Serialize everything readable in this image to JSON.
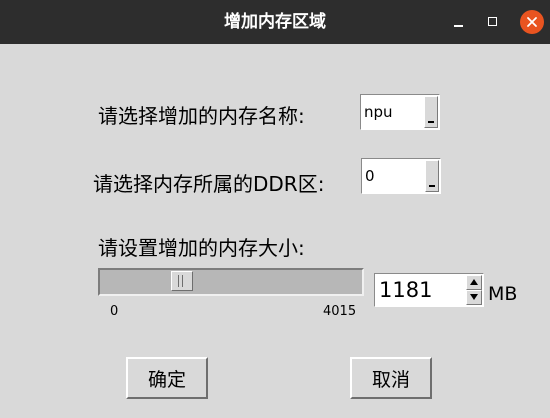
{
  "window": {
    "title": "增加内存区域",
    "controls": [
      "minimize-icon",
      "maximize-icon",
      "close-icon"
    ],
    "close_color": "#e95420"
  },
  "form": {
    "memory_name_label": "请选择增加的内存名称:",
    "memory_name_value": "npu",
    "ddr_label": "请选择内存所属的DDR区:",
    "ddr_value": "0",
    "size_label": "请设置增加的内存大小:",
    "slider": {
      "min": "0",
      "max": "4015",
      "value": 1181
    },
    "size_value": "1181",
    "size_unit": "MB"
  },
  "buttons": {
    "ok": "确定",
    "cancel": "取消"
  }
}
